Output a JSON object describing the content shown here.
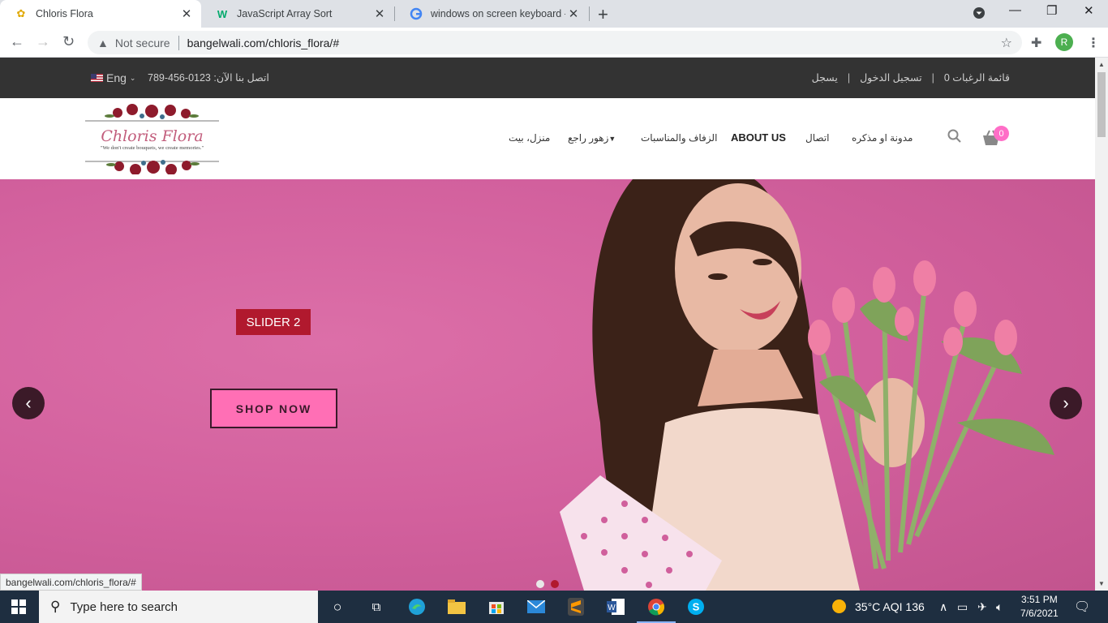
{
  "browser": {
    "tabs": [
      {
        "title": "Chloris Flora",
        "active": true
      },
      {
        "title": "JavaScript Array Sort",
        "active": false
      },
      {
        "title": "windows on screen keyboard - G",
        "active": false
      }
    ],
    "security_label": "Not secure",
    "url": "bangelwali.com/chloris_flora/#",
    "profile_initial": "R",
    "status_url": "bangelwali.com/chloris_flora/#"
  },
  "topbar": {
    "language": "Eng",
    "phone_text": "اتصل بنا الآن: 0123-456-789",
    "links": [
      "قائمة الرغبات 0",
      "تسجيل الدخول",
      "يسجل"
    ]
  },
  "header": {
    "logo_title": "Chloris Flora",
    "logo_tagline": "\"We don't create bouquets, we create memories.\"",
    "nav": [
      "منزل، بيت",
      "زهور راجع",
      "الزفاف والمناسبات",
      "ABOUT US",
      "اتصال",
      "مدونة او مذكره"
    ],
    "cart_count": "0"
  },
  "hero": {
    "slide_label": "SLIDER 2",
    "cta_label": "SHOP NOW",
    "prev": "‹",
    "next": "›"
  },
  "taskbar": {
    "search_placeholder": "Type here to search",
    "weather": "35°C  AQI 136",
    "time": "3:51 PM",
    "date": "7/6/2021"
  },
  "colors": {
    "topbar_bg": "#333333",
    "hero_bg": "#d2609d",
    "slide_label_bg": "#b1192e",
    "cta_bg": "#ff6fb5",
    "cart_badge": "#ff6ec7",
    "taskbar_bg": "#1e2e40"
  }
}
